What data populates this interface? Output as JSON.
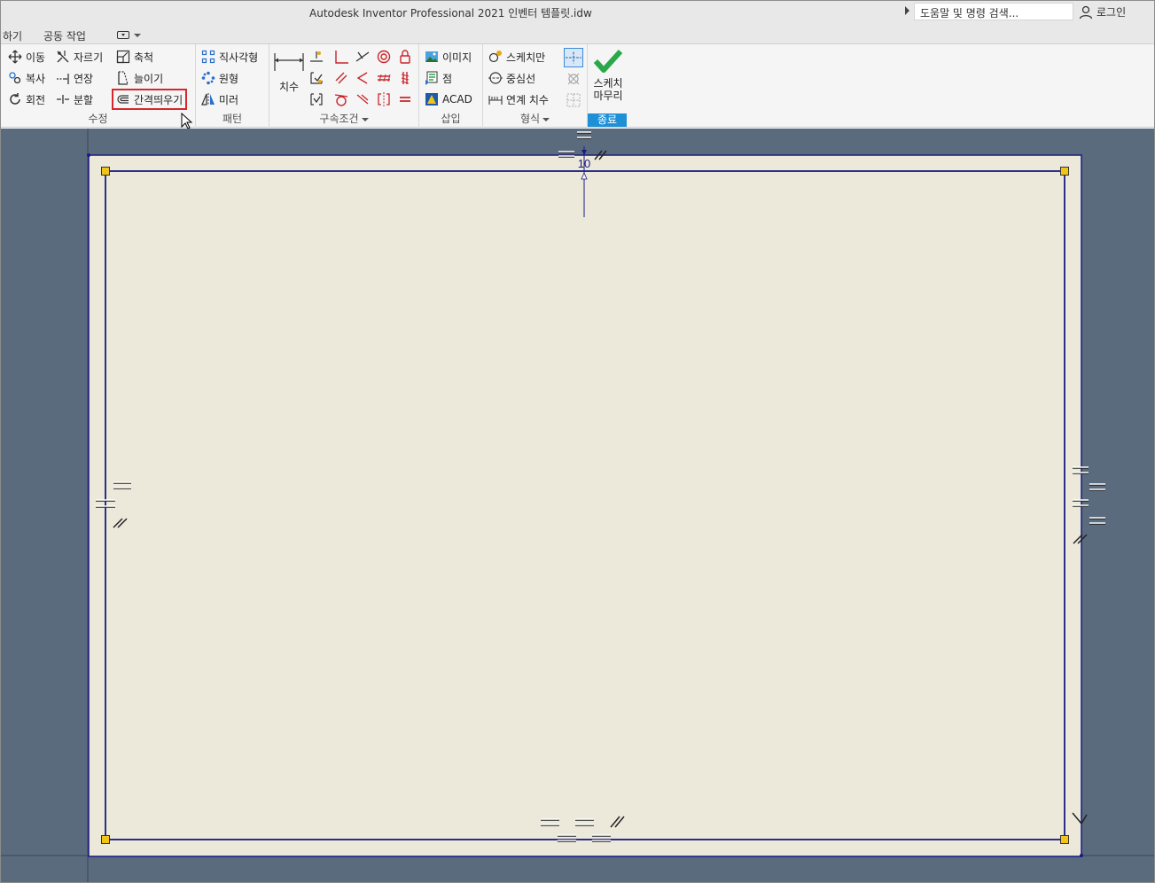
{
  "window": {
    "title": "Autodesk Inventor Professional 2021    인벤터 템플릿.idw",
    "search_placeholder": "도움말 및 명령 검색...",
    "login_label": "로그인"
  },
  "tabs": [
    {
      "label": "하기"
    },
    {
      "label": "공동 작업"
    }
  ],
  "ribbon": {
    "modify": {
      "label": "수정",
      "tools": {
        "move": "이동",
        "trim": "자르기",
        "scale": "축척",
        "copy": "복사",
        "extend": "연장",
        "stretch": "늘이기",
        "rotate": "회전",
        "split": "분할",
        "offset": "간격띄우기"
      }
    },
    "pattern": {
      "label": "패턴",
      "tools": {
        "rectangular": "직사각형",
        "circular": "원형",
        "mirror": "미러"
      }
    },
    "constrain": {
      "label": "구속조건",
      "dimension": "치수"
    },
    "insert": {
      "label": "삽입",
      "tools": {
        "image": "이미지",
        "point": "점",
        "acad": "ACAD"
      }
    },
    "format": {
      "label": "형식",
      "tools": {
        "sketch_only": "스케치만",
        "centerline": "중심선",
        "driven_dimension": "연계 치수"
      }
    },
    "exit": {
      "label": "종료",
      "finish_sketch_line1": "스케치",
      "finish_sketch_line2": "마무리"
    }
  },
  "sketch": {
    "dimension_value": "10"
  },
  "colors": {
    "canvas_bg": "#5b6b7e",
    "sheet_bg": "#ece9db",
    "sketch_line": "#1a1a80",
    "vertex": "#f0c419",
    "accent_blue": "#1e90d6",
    "highlight_red": "#d9262c",
    "check_green": "#2aa84a"
  }
}
